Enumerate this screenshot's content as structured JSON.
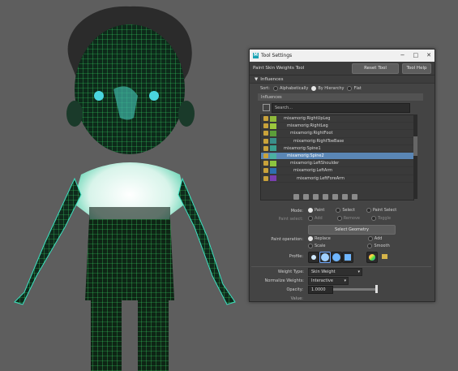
{
  "window": {
    "title": "Tool Settings",
    "tool_name": "Paint Skin Weights Tool",
    "reset_label": "Reset Tool",
    "help_label": "Tool Help",
    "minimize": "−",
    "maximize": "□",
    "close": "✕"
  },
  "influences": {
    "section_label": "Influences",
    "sort_label": "Sort:",
    "sort_options": [
      "Alphabetically",
      "By Hierarchy",
      "Flat"
    ],
    "sub_label": "Influences",
    "search_placeholder": "Search...",
    "items": [
      {
        "name": "mixamorig:RightUpLeg",
        "color": "#8fba3a",
        "selected": false
      },
      {
        "name": "mixamorig:RightLeg",
        "color": "#9bc83d",
        "selected": false
      },
      {
        "name": "mixamorig:RightFoot",
        "color": "#5c9e3a",
        "selected": false
      },
      {
        "name": "mixamorig:RightToeBase",
        "color": "#3a8f8a",
        "selected": false
      },
      {
        "name": "mixamorig:Spine1",
        "color": "#3aa08f",
        "selected": false
      },
      {
        "name": "mixamorig:Spine2",
        "color": "#4bb0a0",
        "selected": true
      },
      {
        "name": "mixamorig:LeftShoulder",
        "color": "#8dc43f",
        "selected": false
      },
      {
        "name": "mixamorig:LeftArm",
        "color": "#2e6fb0",
        "selected": false
      },
      {
        "name": "mixamorig:LeftForeArm",
        "color": "#7a3fb0",
        "selected": false
      }
    ]
  },
  "mode": {
    "label": "Mode:",
    "options": [
      "Paint",
      "Select",
      "Paint Select"
    ],
    "paint_select_label": "Paint select:",
    "paint_select_options": [
      "Add",
      "Remove",
      "Toggle"
    ],
    "select_geometry": "Select Geometry"
  },
  "paint": {
    "operation_label": "Paint operation:",
    "operations": [
      "Replace",
      "Add",
      "Scale",
      "Smooth"
    ],
    "profile_label": "Profile:"
  },
  "weights": {
    "weight_type_label": "Weight Type:",
    "weight_type_value": "Skin Weight",
    "normalize_label": "Normalize Weights:",
    "normalize_value": "Interactive",
    "opacity_label": "Opacity:",
    "opacity_value": "1.0000",
    "value_label": "Value:"
  }
}
